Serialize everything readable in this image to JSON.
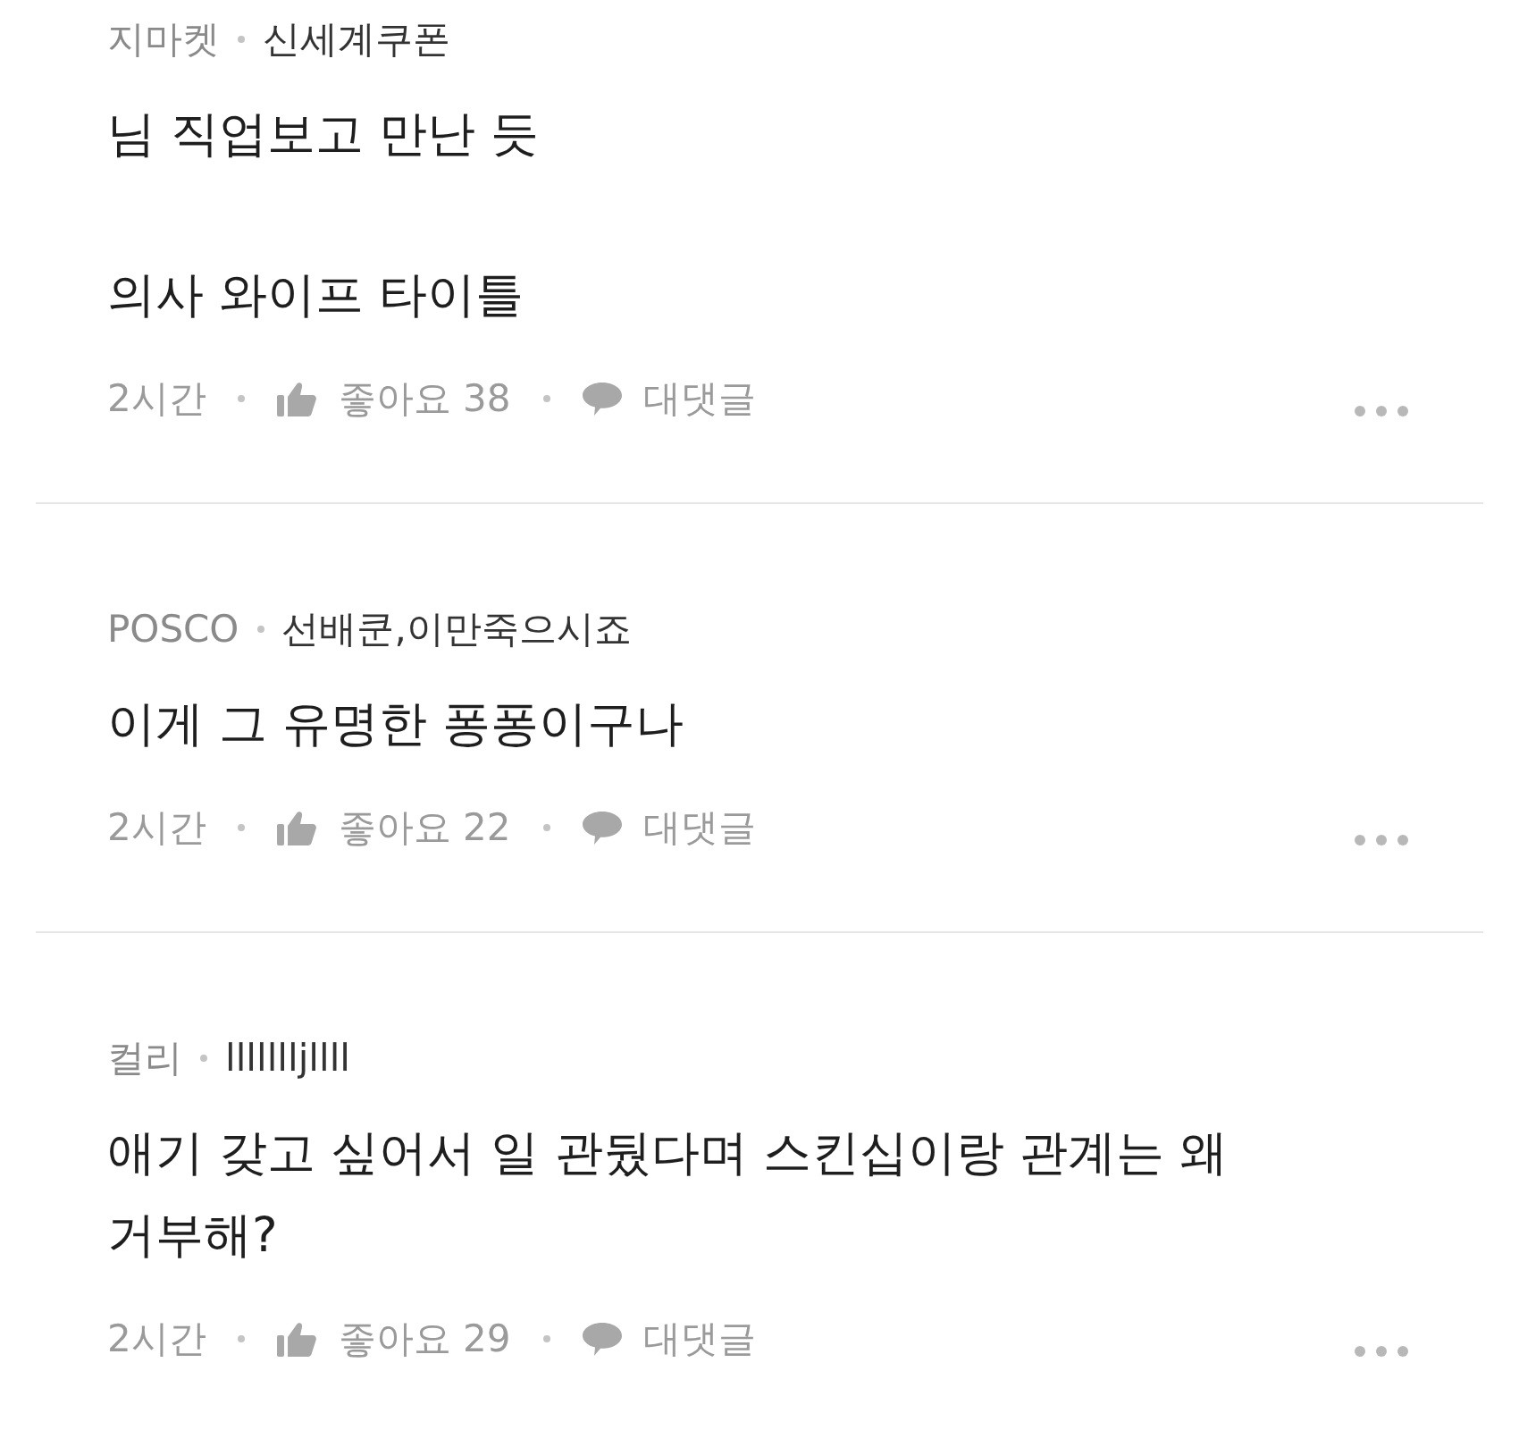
{
  "comments": [
    {
      "company": "지마켓",
      "nickname": "신세계쿠폰",
      "paragraphs": [
        "님 직업보고 만난 듯",
        "의사 와이프 타이틀"
      ],
      "time": "2시간",
      "like_label": "좋아요 38",
      "reply_label": "대댓글"
    },
    {
      "company": "POSCO",
      "nickname": "선배쿤,이만죽으시죠",
      "paragraphs": [
        "이게 그 유명한 퐁퐁이구나"
      ],
      "time": "2시간",
      "like_label": "좋아요 22",
      "reply_label": "대댓글"
    },
    {
      "company": "컬리",
      "nickname": "llllllljllll",
      "paragraphs": [
        "애기 갖고 싶어서 일 관뒀다며 스킨십이랑 관계는 왜 거부해?"
      ],
      "time": "2시간",
      "like_label": "좋아요 29",
      "reply_label": "대댓글"
    }
  ]
}
